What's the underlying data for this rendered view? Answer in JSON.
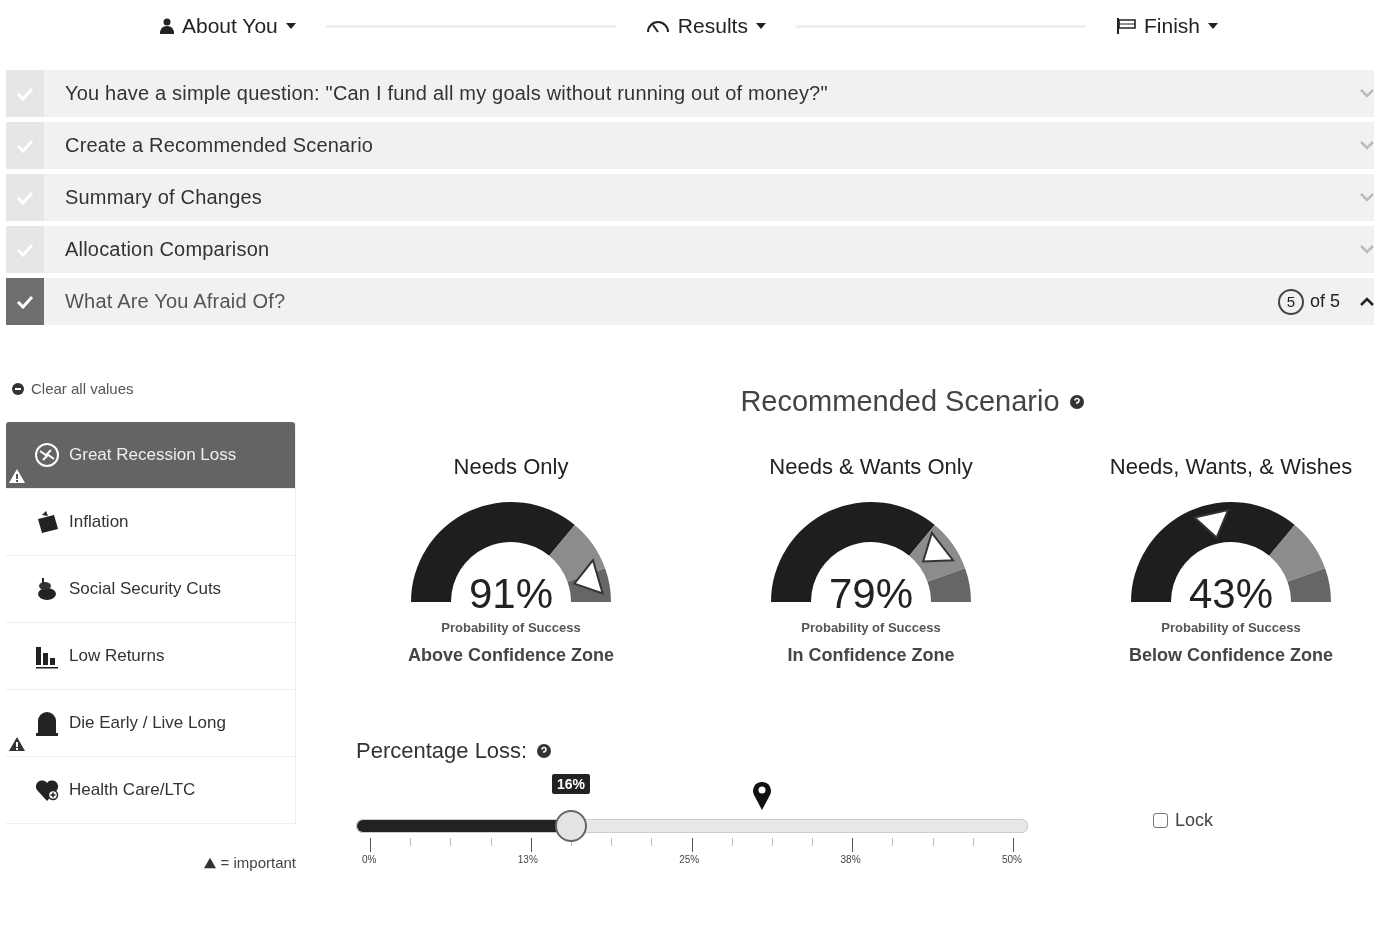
{
  "steps": [
    {
      "label": "About You",
      "selected": false
    },
    {
      "label": "Results",
      "selected": false
    },
    {
      "label": "Finish",
      "selected": false
    }
  ],
  "sections": [
    {
      "title": "You have a simple question: \"Can I fund all my goals without running out of money?\"",
      "expanded": false
    },
    {
      "title": "Create a Recommended Scenario",
      "expanded": false
    },
    {
      "title": "Summary of Changes",
      "expanded": false
    },
    {
      "title": "Allocation Comparison",
      "expanded": false
    },
    {
      "title": "What Are You Afraid Of?",
      "expanded": true,
      "counter": "5",
      "counter_suffix": "of 5"
    }
  ],
  "clear_link": "Clear all values",
  "risks": [
    {
      "label": "Great Recession Loss",
      "selected": true,
      "important": true
    },
    {
      "label": "Inflation",
      "selected": false,
      "important": false
    },
    {
      "label": "Social Security Cuts",
      "selected": false,
      "important": false
    },
    {
      "label": "Low Returns",
      "selected": false,
      "important": false
    },
    {
      "label": "Die Early / Live Long",
      "selected": false,
      "important": true
    },
    {
      "label": "Health Care/LTC",
      "selected": false,
      "important": false
    }
  ],
  "legend": "= important",
  "scenario_title": "Recommended Scenario",
  "gauges": [
    {
      "title": "Needs Only",
      "reading": "91%",
      "level": 0.91,
      "caption": "Probability of Success",
      "zone": "Above Confidence Zone"
    },
    {
      "title": "Needs & Wants Only",
      "reading": "79%",
      "level": 0.79,
      "caption": "Probability of Success",
      "zone": "In Confidence Zone"
    },
    {
      "title": "Needs, Wants, & Wishes",
      "reading": "43%",
      "level": 0.43,
      "caption": "Probability of Success",
      "zone": "Below Confidence Zone"
    }
  ],
  "slider": {
    "label": "Percentage Loss:",
    "value": "16%",
    "level": 0.32,
    "ticks": [
      "0%",
      "13%",
      "25%",
      "38%",
      "50%"
    ]
  },
  "lock": {
    "label": "Lock",
    "checked": false
  }
}
